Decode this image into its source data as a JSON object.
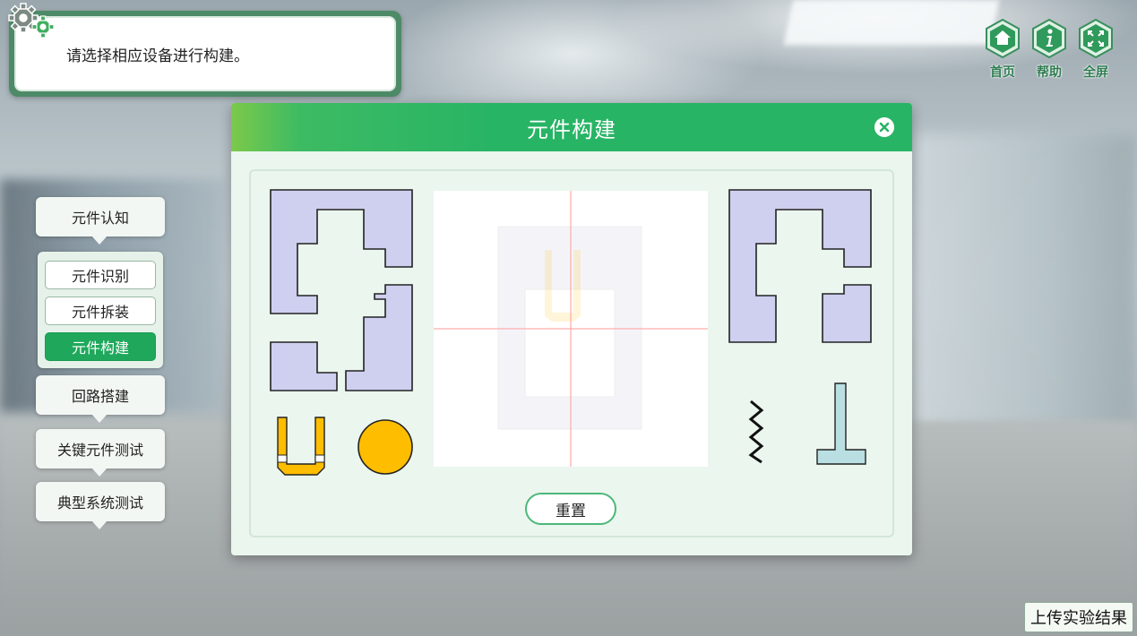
{
  "instruction": {
    "text": "请选择相应设备进行构建。"
  },
  "top_nav": [
    {
      "label": "首页",
      "icon": "home-icon"
    },
    {
      "label": "帮助",
      "icon": "info-icon"
    },
    {
      "label": "全屏",
      "icon": "fullscreen-icon"
    }
  ],
  "side_menu": {
    "tab_recognition": "元件认知",
    "sub_items": [
      {
        "label": "元件识别"
      },
      {
        "label": "元件拆装"
      },
      {
        "label": "元件构建",
        "active": true
      }
    ],
    "tab_circuit": "回路搭建",
    "tab_key_test": "关键元件测试",
    "tab_system_test": "典型系统测试"
  },
  "dialog": {
    "title": "元件构建",
    "reset_label": "重置"
  },
  "upload_label": "上传实验结果",
  "colors": {
    "accent_green": "#27b465",
    "active_green": "#1fa85c",
    "part_lavender": "#cfcff0",
    "part_yellow": "#ffbd00",
    "part_lightblue": "#b9dfe3"
  }
}
